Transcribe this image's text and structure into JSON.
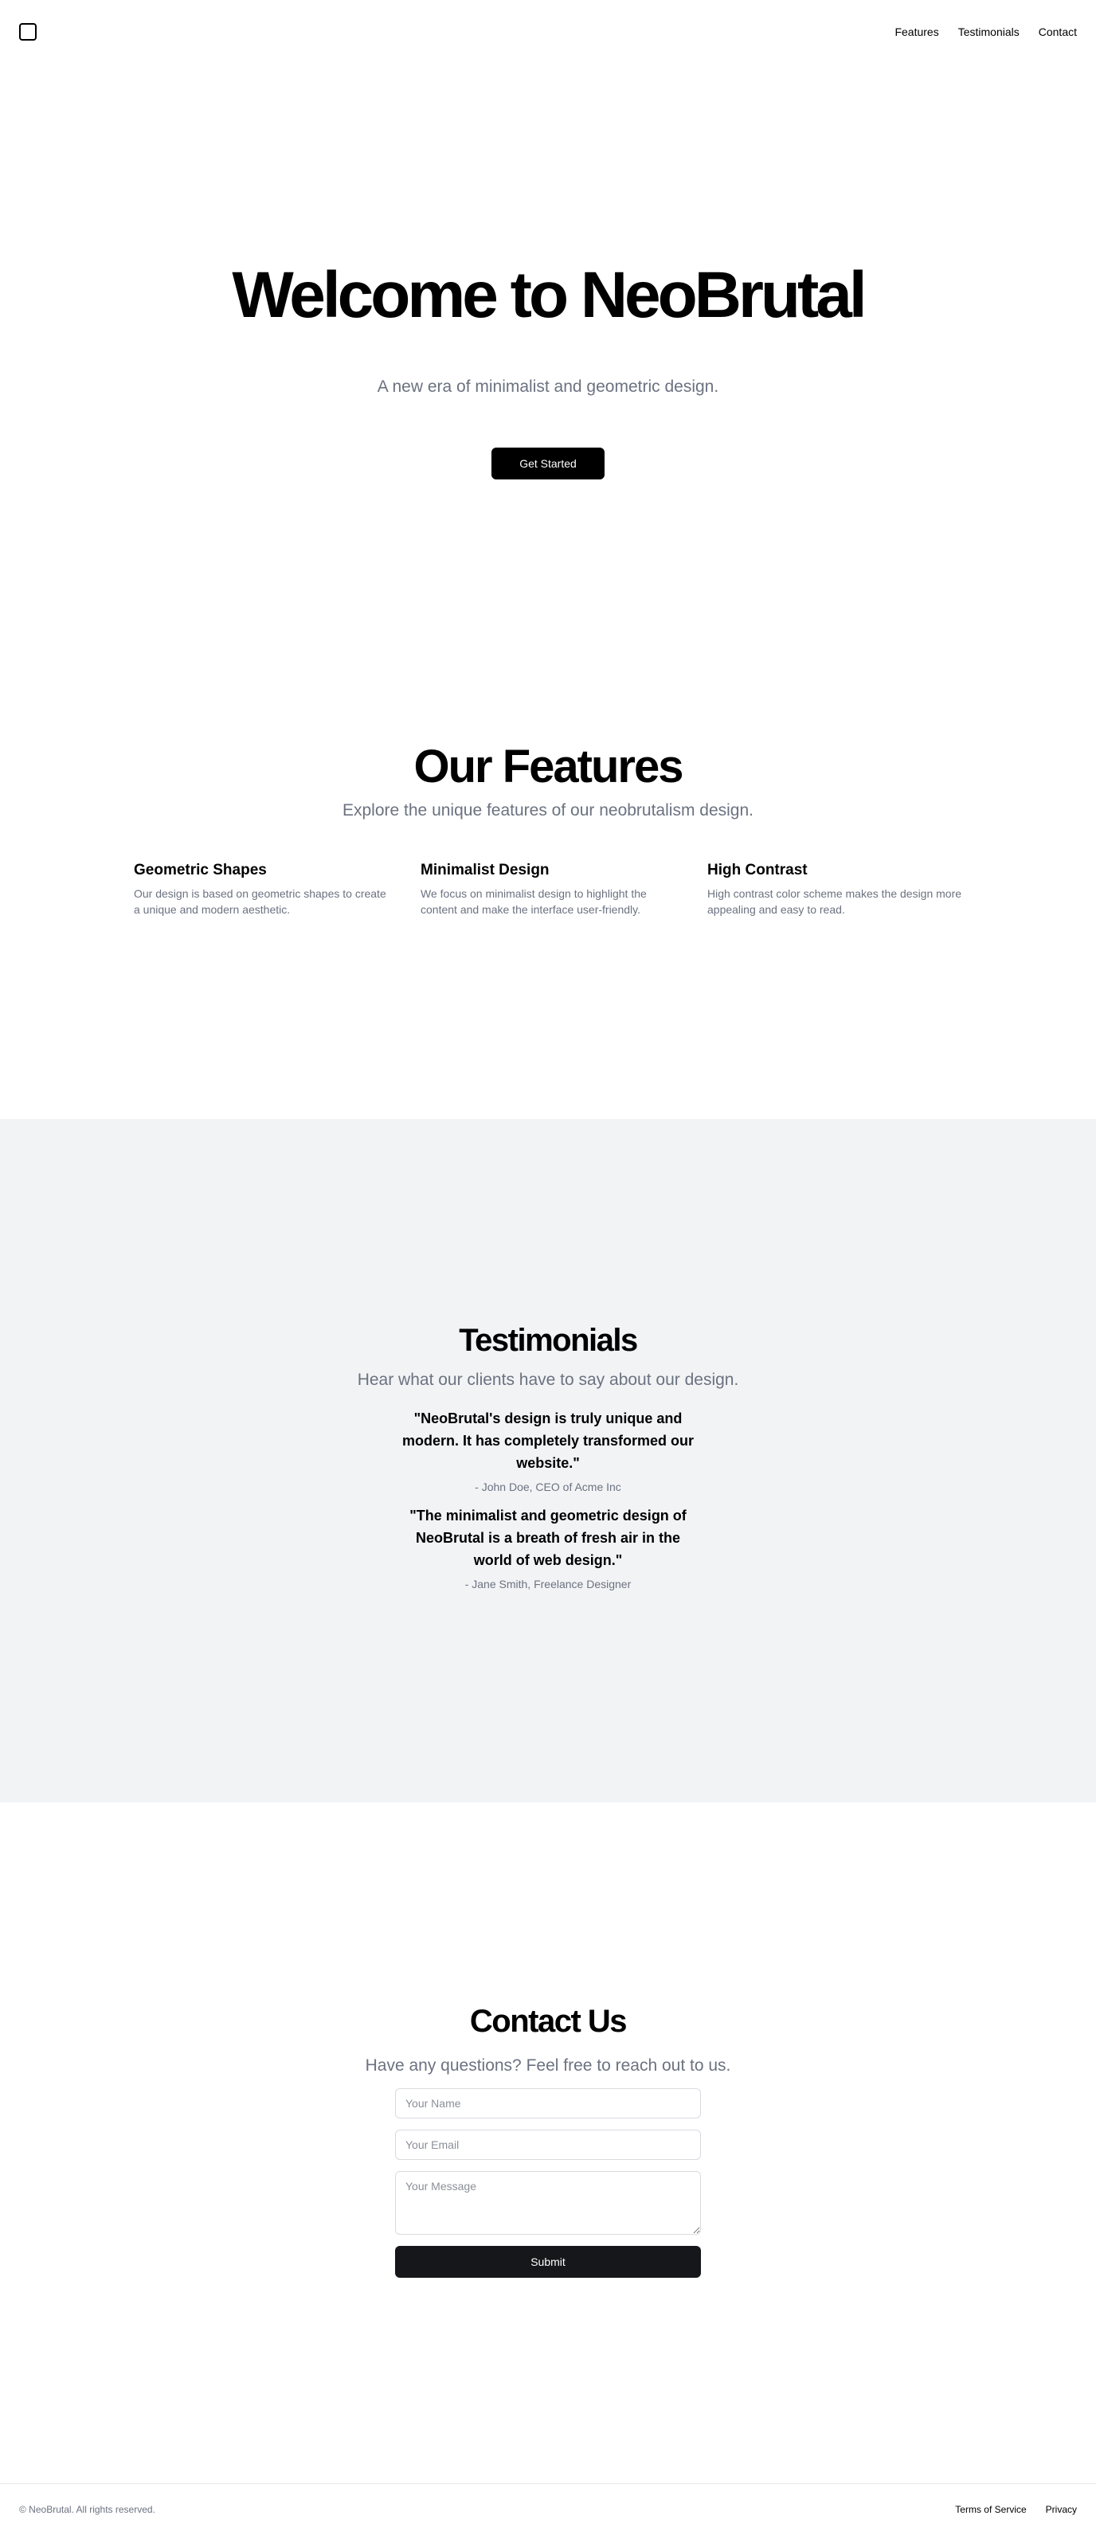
{
  "header": {
    "logo_icon": "square-outline-icon",
    "nav": [
      "Features",
      "Testimonials",
      "Contact"
    ]
  },
  "hero": {
    "title": "Welcome to NeoBrutal",
    "subtitle": "A new era of minimalist and geometric design.",
    "cta_label": "Get Started"
  },
  "features": {
    "title": "Our Features",
    "subtitle": "Explore the unique features of our neobrutalism design.",
    "items": [
      {
        "title": "Geometric Shapes",
        "text": "Our design is based on geometric shapes to create a unique and modern aesthetic."
      },
      {
        "title": "Minimalist Design",
        "text": "We focus on minimalist design to highlight the content and make the interface user-friendly."
      },
      {
        "title": "High Contrast",
        "text": "High contrast color scheme makes the design more appealing and easy to read."
      }
    ]
  },
  "testimonials": {
    "title": "Testimonials",
    "subtitle": "Hear what our clients have to say about our design.",
    "items": [
      {
        "quote": "\"NeoBrutal's design is truly unique and modern. It has completely transformed our website.\"",
        "author": "- John Doe, CEO of Acme Inc"
      },
      {
        "quote": "\"The minimalist and geometric design of NeoBrutal is a breath of fresh air in the world of web design.\"",
        "author": "- Jane Smith, Freelance Designer"
      }
    ]
  },
  "contact": {
    "title": "Contact Us",
    "subtitle": "Have any questions? Feel free to reach out to us.",
    "name_placeholder": "Your Name",
    "email_placeholder": "Your Email",
    "message_placeholder": "Your Message",
    "submit_label": "Submit"
  },
  "footer": {
    "copyright": "© NeoBrutal. All rights reserved.",
    "links": [
      "Terms of Service",
      "Privacy"
    ]
  },
  "colors": {
    "accent": "#000000",
    "muted_text": "#6b7280",
    "testimonials_bg": "#f2f3f5"
  }
}
